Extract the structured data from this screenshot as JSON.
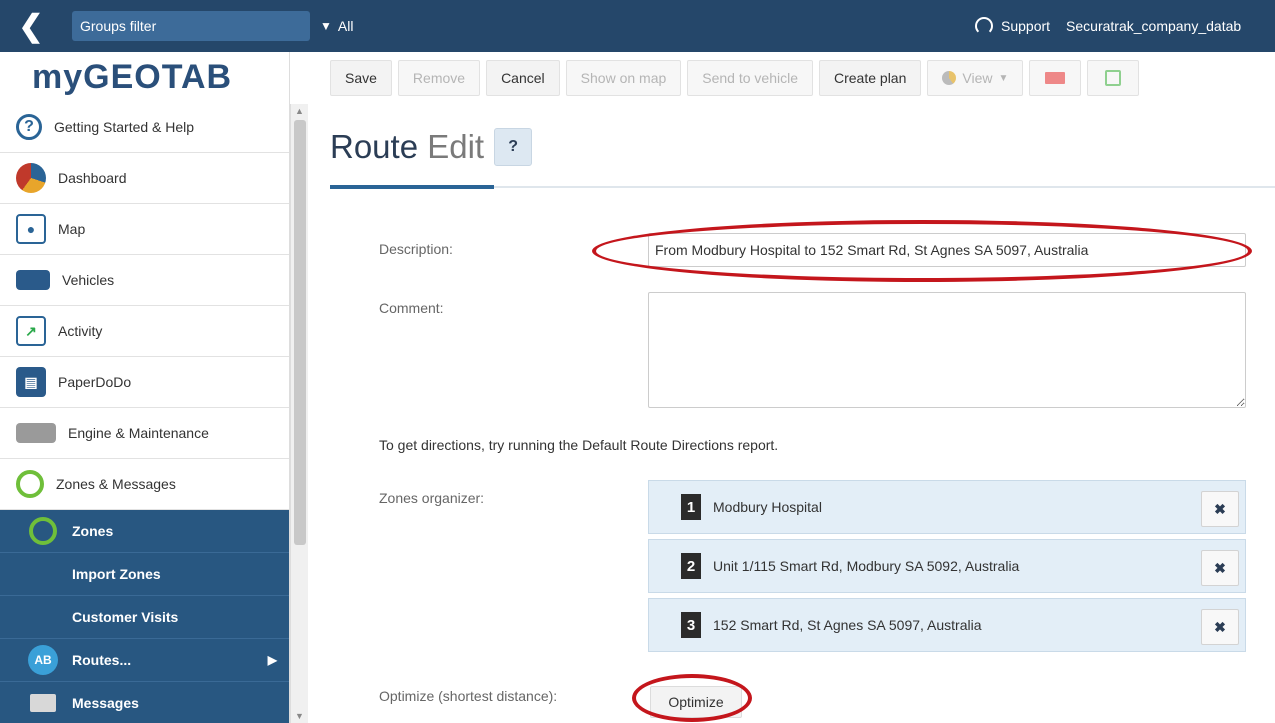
{
  "topbar": {
    "groups_filter": "Groups filter",
    "all_label": "All",
    "support_label": "Support",
    "account": "Securatrak_company_datab"
  },
  "sidebar": {
    "logo": "myGEOTAB",
    "items": [
      {
        "label": "Getting Started & Help",
        "icon": "help-icon"
      },
      {
        "label": "Dashboard",
        "icon": "dashboard-icon"
      },
      {
        "label": "Map",
        "icon": "map-icon"
      },
      {
        "label": "Vehicles",
        "icon": "vehicle-icon"
      },
      {
        "label": "Activity",
        "icon": "activity-icon"
      },
      {
        "label": "PaperDoDo",
        "icon": "paper-icon"
      },
      {
        "label": "Engine & Maintenance",
        "icon": "engine-icon"
      },
      {
        "label": "Zones & Messages",
        "icon": "zone-icon"
      }
    ],
    "sub_items": [
      {
        "label": "Zones"
      },
      {
        "label": "Import Zones"
      },
      {
        "label": "Customer Visits"
      },
      {
        "label": "Routes..."
      },
      {
        "label": "Messages"
      }
    ]
  },
  "toolbar": {
    "save": "Save",
    "remove": "Remove",
    "cancel": "Cancel",
    "show_on_map": "Show on map",
    "send_to_vehicle": "Send to vehicle",
    "create_plan": "Create plan",
    "view": "View"
  },
  "page": {
    "title_main": "Route",
    "title_sub": "Edit",
    "help_btn": "?"
  },
  "form": {
    "description_label": "Description:",
    "description_value": "From Modbury Hospital to 152 Smart Rd, St Agnes SA 5097, Australia",
    "comment_label": "Comment:",
    "hint": "To get directions, try running the Default Route Directions report.",
    "zones_label": "Zones organizer:",
    "zones": [
      {
        "num": "1",
        "name": "Modbury Hospital"
      },
      {
        "num": "2",
        "name": "Unit 1/115 Smart Rd, Modbury SA 5092, Australia"
      },
      {
        "num": "3",
        "name": "152 Smart Rd, St Agnes SA 5097, Australia"
      }
    ],
    "delete_glyph": "✖",
    "optimize_label": "Optimize (shortest distance):",
    "optimize_btn": "Optimize"
  },
  "colors": {
    "topbar": "#25476a",
    "submenu": "#285781",
    "annotation": "#c4161c",
    "zone_row": "#e3eef7"
  }
}
